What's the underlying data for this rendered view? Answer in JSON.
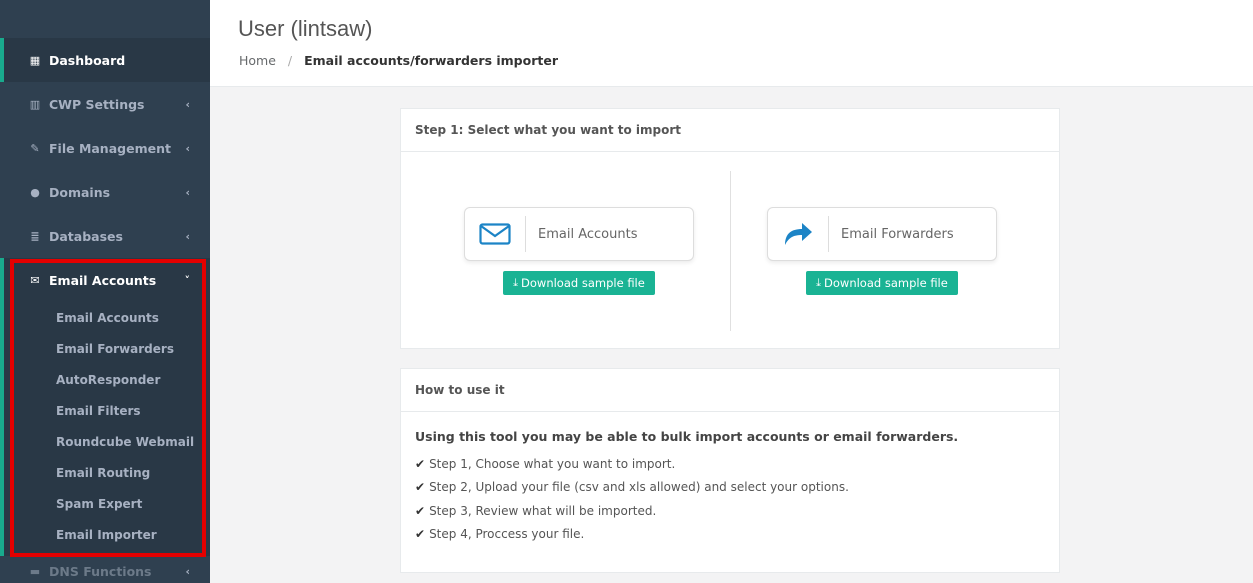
{
  "sidebar": {
    "items": [
      {
        "label": "Dashboard",
        "icon": "grid-icon"
      },
      {
        "label": "CWP Settings",
        "icon": "bar-chart-icon"
      },
      {
        "label": "File Management",
        "icon": "edit-icon"
      },
      {
        "label": "Domains",
        "icon": "globe-icon"
      },
      {
        "label": "Databases",
        "icon": "database-icon"
      },
      {
        "label": "Email Accounts",
        "icon": "envelope-icon"
      }
    ],
    "email_sub": [
      "Email Accounts",
      "Email Forwarders",
      "AutoResponder",
      "Email Filters",
      "Roundcube Webmail",
      "Email Routing",
      "Spam Expert",
      "Email Importer"
    ],
    "dns_label": "DNS Functions"
  },
  "header": {
    "title": "User (lintsaw)",
    "breadcrumb_home": "Home",
    "breadcrumb_sep": "/",
    "breadcrumb_current": "Email accounts/forwarders importer"
  },
  "step1": {
    "heading": "Step 1: Select what you want to import",
    "email_accounts_label": "Email Accounts",
    "email_forwarders_label": "Email Forwarders",
    "download_label": "Download sample file"
  },
  "how": {
    "heading": "How to use it",
    "intro": "Using this tool you may be able to bulk import accounts or email forwarders.",
    "steps": [
      "Step 1, Choose what you want to import.",
      "Step 2, Upload your file (csv and xls allowed) and select your options.",
      "Step 3, Review what will be imported.",
      "Step 4, Proccess your file."
    ]
  },
  "colors": {
    "sidebar_bg": "#2f4050",
    "accent": "#1ab394",
    "highlight": "#e40000",
    "icon_blue": "#1c84c6"
  }
}
